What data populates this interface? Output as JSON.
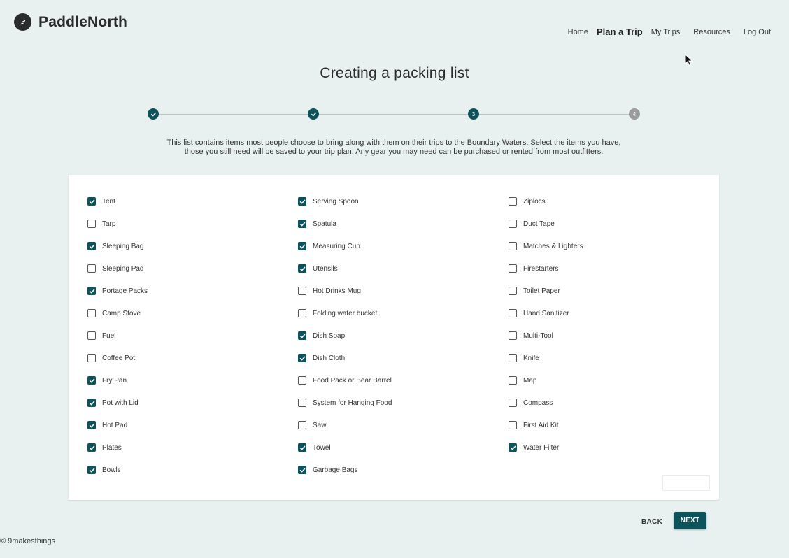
{
  "brand": {
    "name": "PaddleNorth"
  },
  "nav": {
    "items": [
      "Home",
      "Plan a Trip",
      "My Trips",
      "Resources",
      "Log Out"
    ],
    "active": "Plan a Trip"
  },
  "page_title": "Creating a packing list",
  "stepper": {
    "steps": [
      {
        "label": "",
        "state": "done"
      },
      {
        "label": "",
        "state": "done"
      },
      {
        "label": "3",
        "state": "current"
      },
      {
        "label": "4",
        "state": "pending"
      }
    ]
  },
  "intro_text": "This list contains items most people choose to bring along with them on their trips to the Boundary Waters. Select the items you have, those you still need will be saved to your trip plan. Any gear you may need can be purchased or rented from most outfitters.",
  "packing_list": {
    "columns": [
      [
        {
          "label": "Tent",
          "checked": true
        },
        {
          "label": "Tarp",
          "checked": false
        },
        {
          "label": "Sleeping Bag",
          "checked": true
        },
        {
          "label": "Sleeping Pad",
          "checked": false
        },
        {
          "label": "Portage Packs",
          "checked": true
        },
        {
          "label": "Camp Stove",
          "checked": false
        },
        {
          "label": "Fuel",
          "checked": false
        },
        {
          "label": "Coffee Pot",
          "checked": false
        },
        {
          "label": "Fry Pan",
          "checked": true
        },
        {
          "label": "Pot with Lid",
          "checked": true
        },
        {
          "label": "Hot Pad",
          "checked": true
        },
        {
          "label": "Plates",
          "checked": true
        },
        {
          "label": "Bowls",
          "checked": true
        }
      ],
      [
        {
          "label": "Serving Spoon",
          "checked": true
        },
        {
          "label": "Spatula",
          "checked": true
        },
        {
          "label": "Measuring Cup",
          "checked": true
        },
        {
          "label": "Utensils",
          "checked": true
        },
        {
          "label": "Hot Drinks Mug",
          "checked": false
        },
        {
          "label": "Folding water bucket",
          "checked": false
        },
        {
          "label": "Dish Soap",
          "checked": true
        },
        {
          "label": "Dish Cloth",
          "checked": true
        },
        {
          "label": "Food Pack or Bear Barrel",
          "checked": false
        },
        {
          "label": "System for Hanging Food",
          "checked": false
        },
        {
          "label": "Saw",
          "checked": false
        },
        {
          "label": "Towel",
          "checked": true
        },
        {
          "label": "Garbage Bags",
          "checked": true
        }
      ],
      [
        {
          "label": "Ziplocs",
          "checked": false
        },
        {
          "label": "Duct Tape",
          "checked": false
        },
        {
          "label": "Matches & Lighters",
          "checked": false
        },
        {
          "label": "Firestarters",
          "checked": false
        },
        {
          "label": "Toilet Paper",
          "checked": false
        },
        {
          "label": "Hand Sanitizer",
          "checked": false
        },
        {
          "label": "Multi-Tool",
          "checked": false
        },
        {
          "label": "Knife",
          "checked": false
        },
        {
          "label": "Map",
          "checked": false
        },
        {
          "label": "Compass",
          "checked": false
        },
        {
          "label": "First Aid Kit",
          "checked": false
        },
        {
          "label": "Water Filter",
          "checked": true
        }
      ]
    ]
  },
  "buttons": {
    "back": "BACK",
    "next": "NEXT"
  },
  "footer": "© 9makesthings",
  "colors": {
    "accent": "#0c535c",
    "background": "#e8f1ef",
    "pending_step": "#9b9b9b"
  }
}
